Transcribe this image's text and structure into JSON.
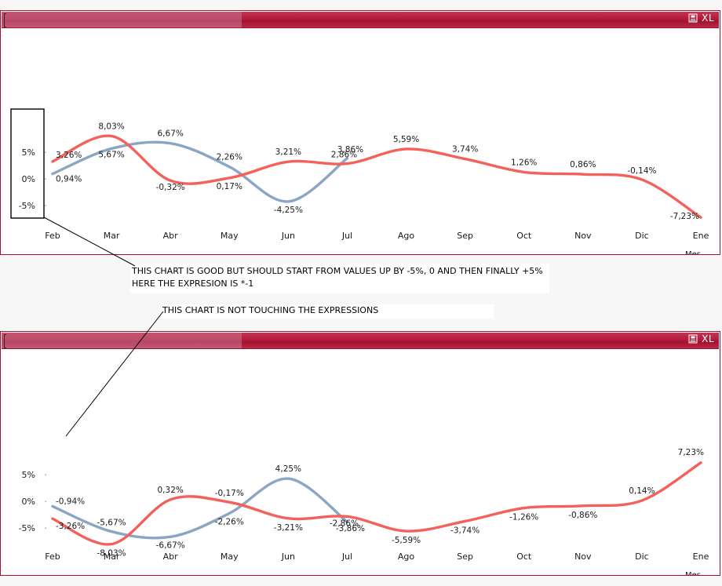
{
  "window": {
    "title_bar_icon": "export-print-icon",
    "export_label": "XL",
    "accent_light": "#bd4f6b",
    "accent_dark": "#a5122f"
  },
  "annotations": [
    {
      "id": "note-1",
      "lines": [
        "THIS CHART IS GOOD BUT SHOULD START FROM VALUES UP BY -5%, 0 AND THEN FINALLY +5%",
        "HERE THE EXPRESION IS *-1"
      ]
    },
    {
      "id": "note-2",
      "lines": [
        "THIS CHART IS NOT TOUCHING THE EXPRESSIONS"
      ]
    }
  ],
  "chart_data": [
    {
      "type": "line",
      "id": "chart-top",
      "title": "",
      "xlabel": "Mes",
      "ylabel": "",
      "ylim": [
        -9,
        9
      ],
      "grid": false,
      "legend": "none",
      "ytick_labels": [
        "5%",
        "0%",
        "-5%"
      ],
      "ytick_values": [
        5,
        0,
        -5
      ],
      "categories": [
        "Feb",
        "Mar",
        "Abr",
        "May",
        "Jun",
        "Jul",
        "Ago",
        "Sep",
        "Oct",
        "Nov",
        "Dic",
        "Ene"
      ],
      "series": [
        {
          "name": "red-series",
          "color": "#f4615a",
          "values": [
            3.26,
            8.03,
            -0.32,
            0.17,
            3.21,
            2.86,
            5.59,
            3.74,
            1.26,
            0.86,
            -0.14,
            -7.23
          ],
          "labels": [
            "3,26%",
            "8,03%",
            "-0,32%",
            "0,17%",
            "3,21%",
            "2,86%",
            "5,59%",
            "3,74%",
            "1,26%",
            "0,86%",
            "-0,14%",
            "-7,23%"
          ]
        },
        {
          "name": "blue-series",
          "color": "#8aa6c4",
          "values": [
            0.94,
            5.67,
            6.67,
            2.26,
            -4.25,
            3.86,
            null,
            null,
            null,
            null,
            null,
            null
          ],
          "labels": [
            "0,94%",
            "5,67%",
            "6,67%",
            "2,26%",
            "-4,25%",
            "3,86%"
          ]
        }
      ]
    },
    {
      "type": "line",
      "id": "chart-bottom",
      "title": "",
      "xlabel": "Mes",
      "ylabel": "",
      "ylim": [
        -9,
        9
      ],
      "grid": false,
      "legend": "none",
      "ytick_labels": [
        "5%",
        "0%",
        "-5%"
      ],
      "ytick_values": [
        5,
        0,
        -5
      ],
      "categories": [
        "Feb",
        "Mar",
        "Abr",
        "May",
        "Jun",
        "Jul",
        "Ago",
        "Sep",
        "Oct",
        "Nov",
        "Dic",
        "Ene"
      ],
      "series": [
        {
          "name": "red-series",
          "color": "#f4615a",
          "values": [
            -3.26,
            -8.03,
            0.32,
            -0.17,
            -3.21,
            -2.86,
            -5.59,
            -3.74,
            -1.26,
            -0.86,
            0.14,
            7.23
          ],
          "labels": [
            "-3,26%",
            "-8,03%",
            "0,32%",
            "-0,17%",
            "-3,21%",
            "-2,86%",
            "-5,59%",
            "-3,74%",
            "-1,26%",
            "-0,86%",
            "0,14%",
            "7,23%"
          ]
        },
        {
          "name": "blue-series",
          "color": "#8aa6c4",
          "values": [
            -0.94,
            -5.67,
            -6.67,
            -2.26,
            4.25,
            -3.86,
            null,
            null,
            null,
            null,
            null,
            null
          ],
          "labels": [
            "-0,94%",
            "-5,67%",
            "-6,67%",
            "-2,26%",
            "4,25%",
            "-3,86%"
          ]
        }
      ]
    }
  ]
}
